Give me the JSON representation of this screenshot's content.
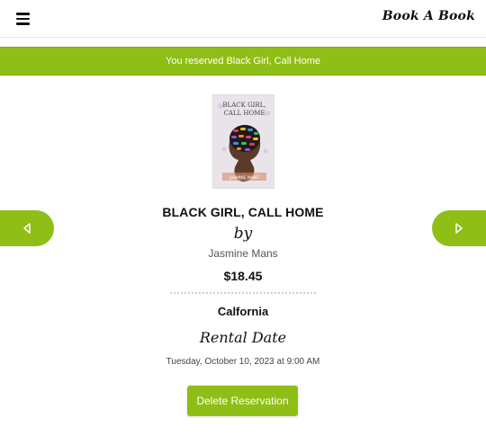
{
  "header": {
    "logo_text": "Book A Book",
    "menu_icon": "hamburger-menu-icon"
  },
  "banner": {
    "message": "You reserved Black Girl, Call Home",
    "color": "#8fbe16"
  },
  "book": {
    "cover_title_line1": "BLACK GIRL,",
    "cover_title_line2": "CALL HOME",
    "cover_author": "JASMINE MANS",
    "title": "BLACK GIRL, CALL HOME",
    "by_label": "by",
    "author": "Jasmine Mans",
    "price": "$18.45"
  },
  "reservation": {
    "location": "Calfornia",
    "rental_label": "Rental Date",
    "rental_date": "Tuesday, October 10, 2023 at 9:00 AM",
    "delete_label": "Delete Reservation"
  },
  "navigation": {
    "prev_icon": "triangle-left-icon",
    "next_icon": "triangle-right-icon"
  },
  "colors": {
    "accent": "#8fbe16",
    "text": "#111111"
  }
}
